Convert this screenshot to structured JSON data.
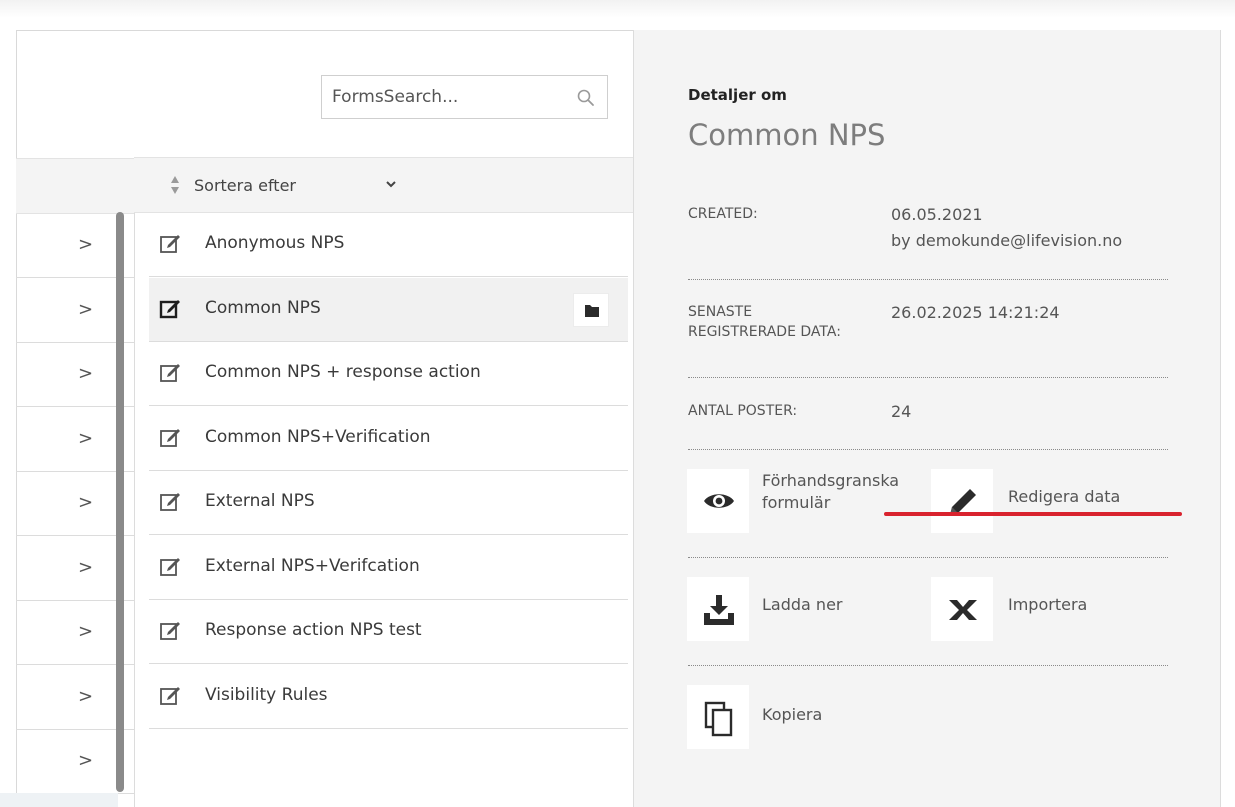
{
  "search": {
    "placeholder": "FormsSearch..."
  },
  "sort": {
    "label": "Sortera efter"
  },
  "forms": [
    {
      "label": "Anonymous NPS",
      "selected": false
    },
    {
      "label": "Common NPS",
      "selected": true
    },
    {
      "label": "Common NPS + response action",
      "selected": false
    },
    {
      "label": "Common NPS+Verification",
      "selected": false
    },
    {
      "label": "External NPS",
      "selected": false
    },
    {
      "label": "External NPS+Verifcation",
      "selected": false
    },
    {
      "label": "Response action NPS test",
      "selected": false
    },
    {
      "label": "Visibility Rules",
      "selected": false
    }
  ],
  "left_column": {
    "chevron": ">"
  },
  "details": {
    "heading": "Detaljer om",
    "title": "Common NPS",
    "created_label": "CREATED:",
    "created_date": "06.05.2021",
    "created_by": "by demokunde@lifevision.no",
    "last_data_label_1": "SENASTE",
    "last_data_label_2": "REGISTRERADE DATA:",
    "last_data_value": "26.02.2025 14:21:24",
    "count_label": "ANTAL POSTER:",
    "count_value": "24",
    "actions": {
      "preview_1": "Förhandsgranska",
      "preview_2": "formulär",
      "edit": "Redigera data",
      "download": "Ladda ner",
      "import": "Importera",
      "copy": "Kopiera"
    }
  },
  "colors": {
    "panel_bg": "#f4f4f4",
    "annotation_red": "#d9232e"
  }
}
